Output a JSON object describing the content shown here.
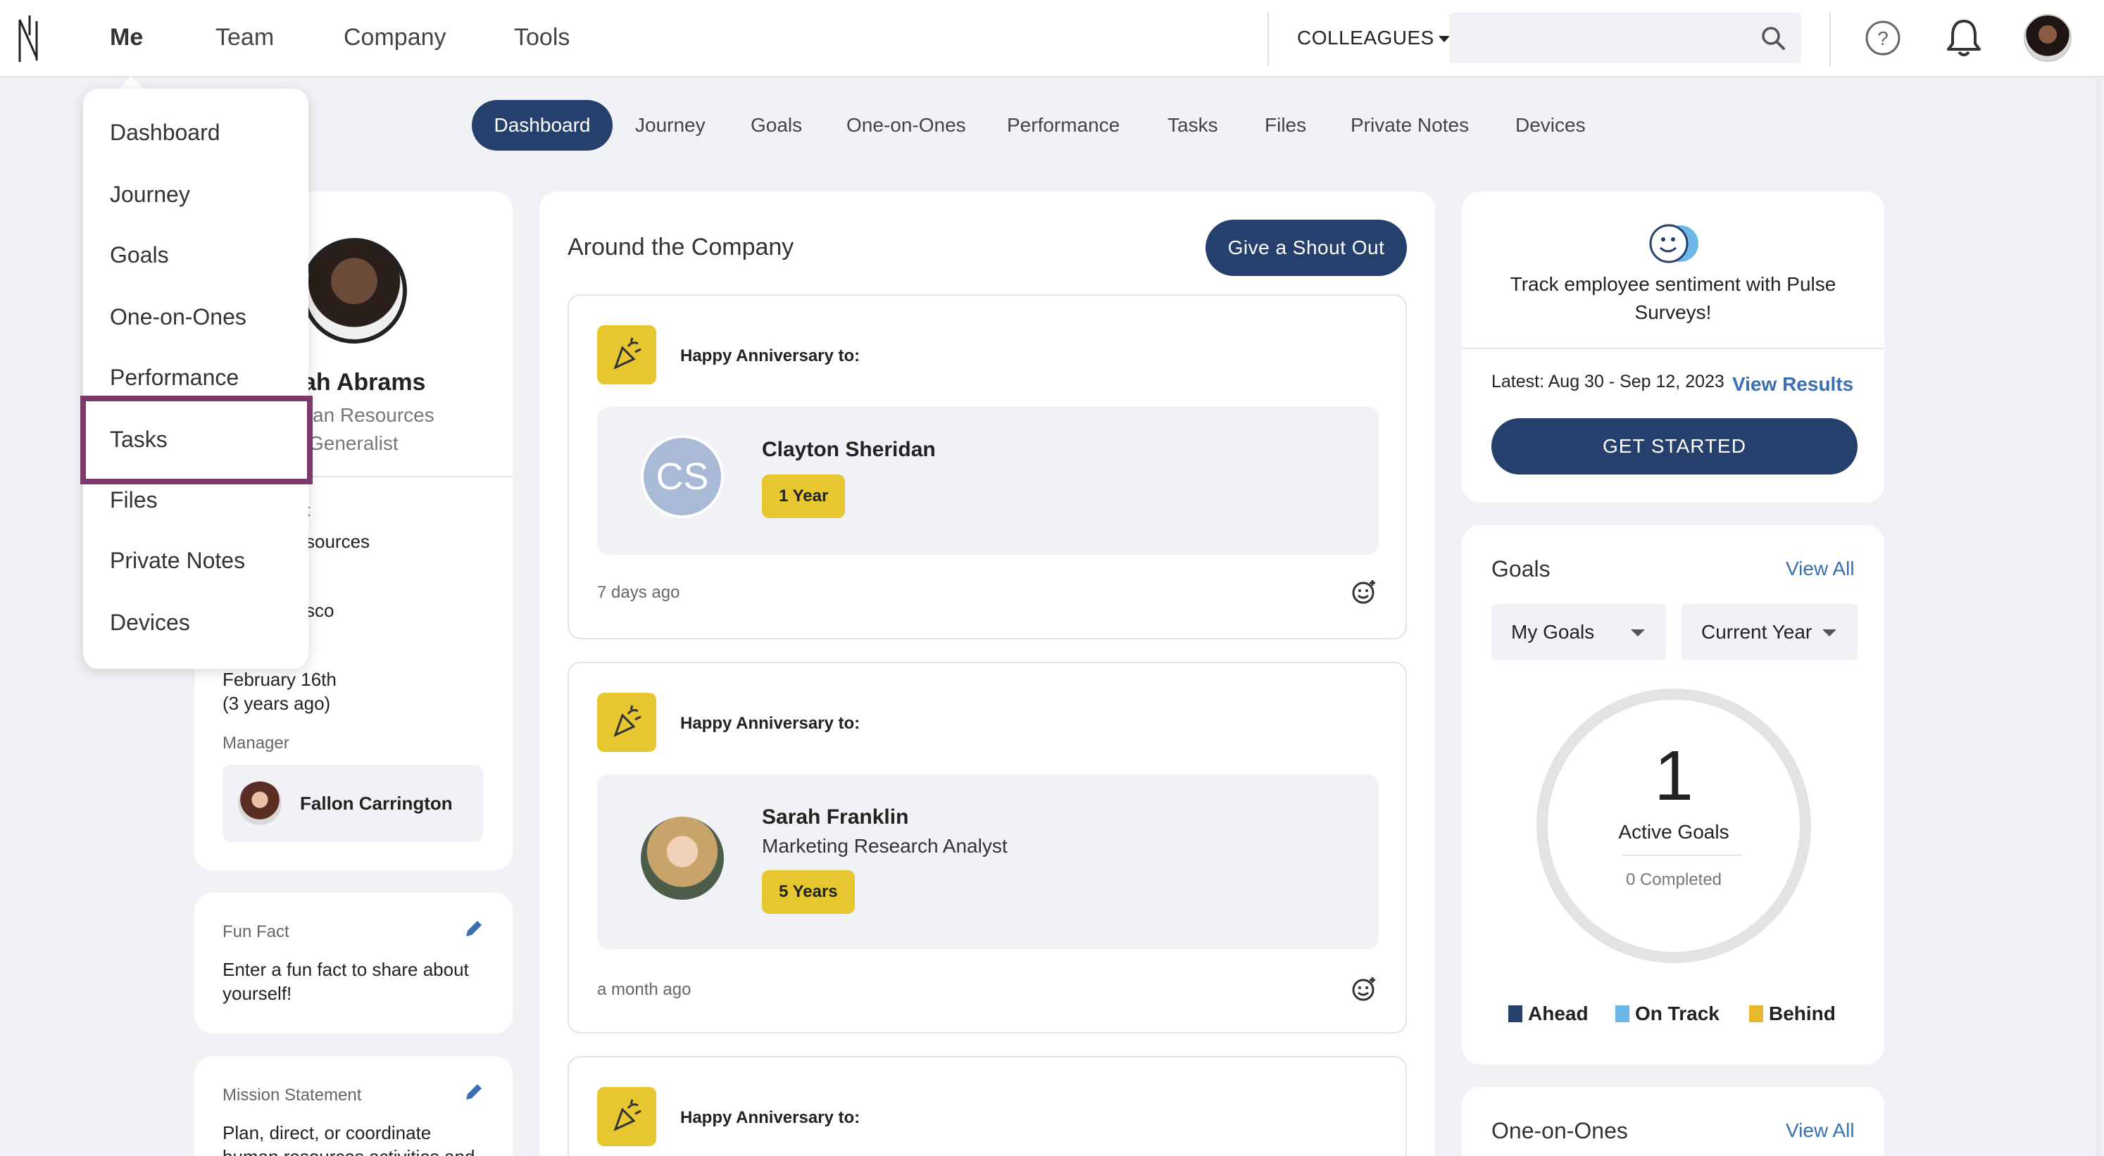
{
  "topnav": {
    "items": [
      "Me",
      "Team",
      "Company",
      "Tools"
    ],
    "colleagues_label": "COLLEAGUES",
    "search_placeholder": ""
  },
  "subtabs": [
    "Dashboard",
    "Journey",
    "Goals",
    "One-on-Ones",
    "Performance",
    "Tasks",
    "Files",
    "Private Notes",
    "Devices"
  ],
  "dropdown": {
    "items": [
      "Dashboard",
      "Journey",
      "Goals",
      "One-on-Ones",
      "Performance",
      "Tasks",
      "Files",
      "Private Notes",
      "Devices"
    ]
  },
  "profile": {
    "name_fragment": "ah Abrams",
    "title_line1": "an Resources",
    "title_line2": "Generalist",
    "dept_fragment_label": "t",
    "dept_fragment": "sources",
    "location_fragment": "sco",
    "start_date": "February 16th",
    "tenure": "(3 years ago)",
    "manager_label": "Manager",
    "manager_name": "Fallon Carrington"
  },
  "fun_fact": {
    "label": "Fun Fact",
    "text_line1": "Enter a fun fact to share about",
    "text_line2": "yourself!"
  },
  "mission": {
    "label": "Mission Statement",
    "text_line1": "Plan, direct, or coordinate",
    "text_line2": "human resources activities and"
  },
  "feed": {
    "title": "Around the Company",
    "shout_out_label": "Give a Shout Out",
    "posts": [
      {
        "heading": "Happy Anniversary to:",
        "initials": "CS",
        "name": "Clayton Sheridan",
        "job_title": "",
        "badge": "1 Year",
        "time": "7 days ago"
      },
      {
        "heading": "Happy Anniversary to:",
        "initials": "",
        "name": "Sarah Franklin",
        "job_title": "Marketing Research Analyst",
        "badge": "5 Years",
        "time": "a month ago"
      },
      {
        "heading": "Happy Anniversary to:"
      }
    ]
  },
  "pulse": {
    "text_line1": "Track employee sentiment with Pulse",
    "text_line2": "Surveys!",
    "latest": "Latest: Aug 30 - Sep 12, 2023",
    "view_results": "View Results",
    "get_started": "GET STARTED"
  },
  "goals": {
    "title": "Goals",
    "view_all": "View All",
    "filter_owner": "My Goals",
    "filter_period": "Current Year",
    "active_count": "1",
    "active_label": "Active Goals",
    "completed_label": "0 Completed",
    "legend": [
      {
        "label": "Ahead",
        "color": "#26406d"
      },
      {
        "label": "On Track",
        "color": "#6fb6e8"
      },
      {
        "label": "Behind",
        "color": "#e6b830"
      }
    ]
  },
  "one_on_ones": {
    "title": "One-on-Ones",
    "view_all": "View All"
  },
  "colors": {
    "primary": "#26406d",
    "accent_yellow": "#e6c730",
    "link": "#3a6fb0",
    "highlight": "#7b3a6a"
  }
}
